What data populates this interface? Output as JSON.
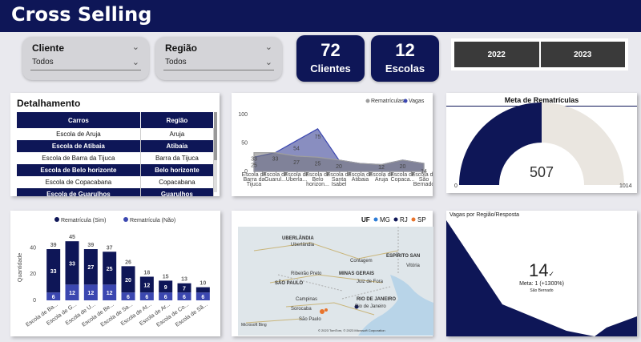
{
  "app_title": "Cross Selling",
  "filters": {
    "cliente": {
      "label": "Cliente",
      "value": "Todos"
    },
    "regiao": {
      "label": "Região",
      "value": "Todos"
    }
  },
  "kpis": {
    "clientes": {
      "value": "72",
      "label": "Clientes"
    },
    "escolas": {
      "value": "12",
      "label": "Escolas"
    }
  },
  "years": [
    "2022",
    "2023"
  ],
  "detalhamento": {
    "title": "Detalhamento",
    "columns": [
      "Carros",
      "Região"
    ],
    "rows": [
      [
        "Escola de Aruja",
        "Aruja"
      ],
      [
        "Escola de Atibaia",
        "Atibaia"
      ],
      [
        "Escola de Barra da Tijuca",
        "Barra da Tijuca"
      ],
      [
        "Escola de Belo horizonte",
        "Belo horizonte"
      ],
      [
        "Escola de Copacabana",
        "Copacabana"
      ],
      [
        "Escola de Guarulhos",
        "Guarulhos"
      ]
    ]
  },
  "meta": {
    "title": "Meta de Rematrículas",
    "value": "507",
    "min": "0",
    "max": "1014"
  },
  "vagas": {
    "title": "Vagas por Região/Resposta",
    "value": "14",
    "meta_text": "Meta: 1 (+1300%)",
    "sub": "São Bernado"
  },
  "map": {
    "legend_title": "UF",
    "legend": [
      "MG",
      "RJ",
      "SP"
    ],
    "labels": [
      "UBERLÂNDIA",
      "Uberlândia",
      "ESPÍRITO SAN",
      "Contagem",
      "Vitória",
      "Ribeirão Preto",
      "SÃO PAULO",
      "Juiz de Fora",
      "MINAS GERAIS",
      "Campinas",
      "Sorocaba",
      "São Paulo",
      "Rio de Janeiro",
      "RIO DE JANEIRO"
    ],
    "copyright": "© 2023 TomTom, © 2023 Microsoft Corporation",
    "bing": "Microsoft Bing"
  },
  "chart_data": [
    {
      "type": "area",
      "series": [
        {
          "name": "Rematrículas",
          "values": [
            33,
            33,
            27,
            25,
            20,
            14,
            12,
            20,
            14
          ]
        },
        {
          "name": "Vagas",
          "values": [
            25,
            33,
            54,
            75,
            20,
            14,
            12,
            20,
            14
          ]
        }
      ],
      "categories": [
        "Escola de Barra da Tijuca",
        "Escola de Guarul...",
        "Escola de Uberla...",
        "Escola de Belo horizon...",
        "Escola de Santa Isabel",
        "Escola de Atibaia",
        "Escola de Aruja",
        "Escola de Copaca...",
        "Escola de São Bernado"
      ],
      "tick_labels": [
        [
          "Escola de",
          "Barra da",
          "Tijuca"
        ],
        [
          "Escola de",
          "Guarul..."
        ],
        [
          "Escola de",
          "Uberla..."
        ],
        [
          "Escola de",
          "Belo",
          "horizon..."
        ],
        [
          "Escola de",
          "Santa",
          "Isabel"
        ],
        [
          "Escola de",
          "Atibaia"
        ],
        [
          "Escola de",
          "Aruja"
        ],
        [
          "Escola de",
          "Copaca..."
        ],
        [
          "Escola de",
          "São",
          "Bernado"
        ]
      ],
      "labels": [
        {
          "series": "Rematrículas",
          "values": [
            "33",
            "33",
            "27",
            "25",
            "20",
            "",
            "12",
            "20",
            ""
          ]
        },
        {
          "series": "Vagas",
          "values": [
            "25",
            "",
            "54",
            "75",
            "",
            "",
            "",
            "",
            "14"
          ]
        }
      ],
      "yticks": [
        0,
        50,
        100
      ],
      "ylim": [
        0,
        110
      ],
      "legend": "top-right"
    },
    {
      "type": "bar",
      "stacked": true,
      "ylabel": "Quantidade",
      "categories": [
        "Escola de Ba...",
        "Escola de G...",
        "Escola de U...",
        "Escola de Be...",
        "Escola de Sa...",
        "Escola de At...",
        "Escola de Ar...",
        "Escola de Co...",
        "Escola de Sã..."
      ],
      "series": [
        {
          "name": "Rematrícula (Não)",
          "values": [
            6,
            12,
            12,
            12,
            6,
            6,
            6,
            6,
            6
          ]
        },
        {
          "name": "Rematrícula (Sim)",
          "values": [
            33,
            33,
            27,
            25,
            20,
            12,
            9,
            7,
            4
          ]
        }
      ],
      "inner_labels": {
        "nao": [
          "6",
          "12",
          "12",
          "12",
          "6",
          "6",
          "6",
          "6",
          "6"
        ],
        "sim": [
          "33",
          "33",
          "27",
          "25",
          "20",
          "12",
          "9",
          "7",
          ""
        ]
      },
      "totals": [
        "39",
        "45",
        "39",
        "37",
        "26",
        "18",
        "15",
        "13",
        "10"
      ],
      "yticks": [
        0,
        20,
        40
      ],
      "ylim": [
        0,
        50
      ],
      "legend": "top"
    }
  ],
  "colors": {
    "navy": "#0e1657",
    "bar_light": "#3b47b0",
    "area_grey": "#9e9e9e",
    "gauge_bg": "#eae6e0"
  }
}
